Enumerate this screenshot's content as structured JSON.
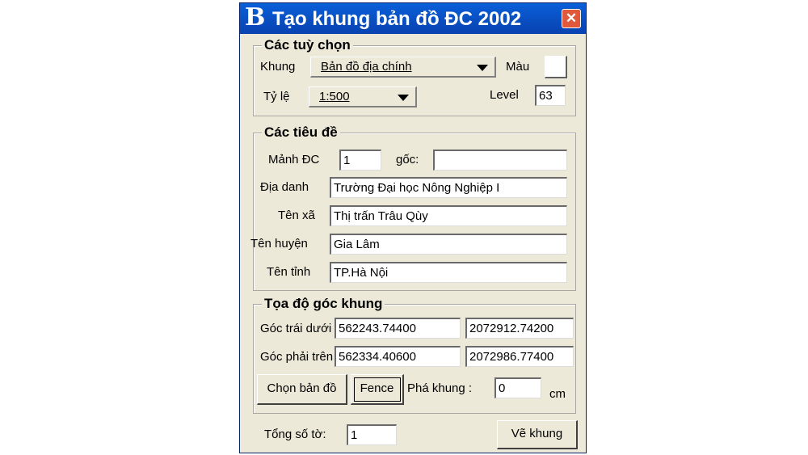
{
  "window": {
    "title": "Tạo khung bản đồ ĐC 2002",
    "logo_glyph": "B",
    "close_glyph": "✕"
  },
  "options": {
    "group_title": "Các tuỳ chọn",
    "frame_label": "Khung",
    "frame_value": "Bản đồ địa chính",
    "color_label": "Màu",
    "scale_label": "Tỷ lệ",
    "scale_value": "1:500",
    "level_label": "Level",
    "level_value": "63"
  },
  "titles": {
    "group_title": "Các tiêu đề",
    "sheet_label": "Mảnh ĐC",
    "sheet_value": "1",
    "origin_label": "gốc:",
    "origin_value": "",
    "place_label": "Địa danh",
    "place_value": "Trường Đại học Nông Nghiệp I",
    "commune_label": "Tên xã",
    "commune_value": "Thị trấn Trâu Qùy",
    "district_label": "Tên huyện",
    "district_value": "Gia Lâm",
    "province_label": "Tên tỉnh",
    "province_value": "TP.Hà Nội"
  },
  "coords": {
    "group_title": "Tọa độ góc khung",
    "bottom_left_label": "Góc trái dưới",
    "bottom_left_x": "562243.74400",
    "bottom_left_y": "2072912.74200",
    "top_right_label": "Góc phải trên",
    "top_right_x": "562334.40600",
    "top_right_y": "2072986.77400",
    "choose_map_button": "Chọn bản đồ",
    "fence_button": "Fence",
    "break_frame_label": "Phá khung :",
    "break_frame_value": "0",
    "unit_label": "cm"
  },
  "footer": {
    "total_sheets_label": "Tổng số tờ:",
    "total_sheets_value": "1",
    "draw_frame_button": "Vẽ khung"
  },
  "colors": {
    "title_bar": "#0842b0",
    "window_bg": "#ece9d8",
    "close_button": "#e2583a"
  }
}
